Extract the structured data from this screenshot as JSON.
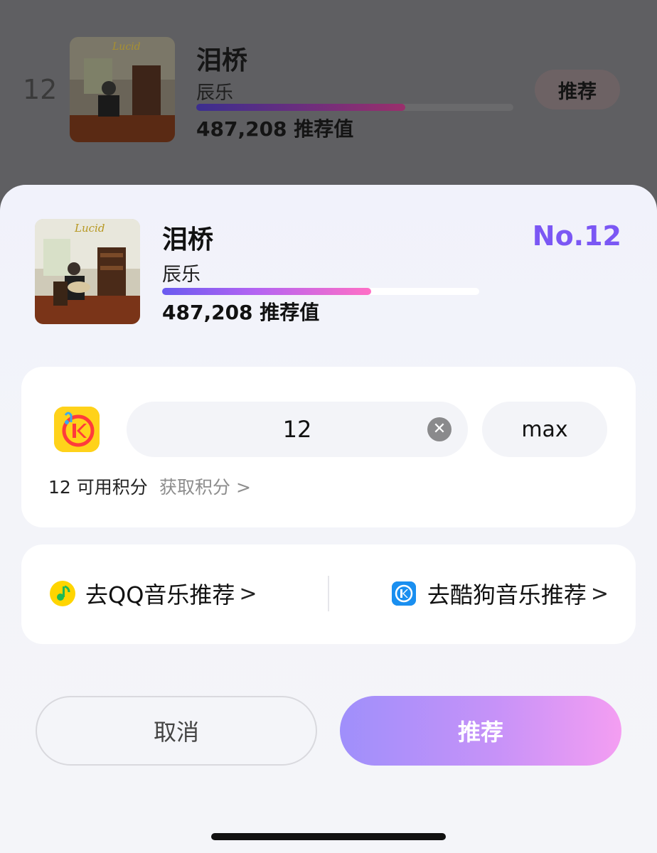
{
  "background_row": {
    "rank": "12",
    "song_title": "泪桥",
    "artist": "辰乐",
    "progress": 0.66,
    "score": "487,208 推荐值",
    "button_label": "推荐",
    "cover_text": "Lucid"
  },
  "sheet": {
    "song_title": "泪桥",
    "artist": "辰乐",
    "progress": 0.66,
    "score": "487,208 推荐值",
    "rank_label": "No.12",
    "cover_text": "Lucid"
  },
  "vote_card": {
    "app_icon": "kuwo-music-icon",
    "quantity_value": "12",
    "max_label": "max",
    "available_points": "12 可用积分",
    "get_points_link": "获取积分 >"
  },
  "links": {
    "qq_label": "去QQ音乐推荐",
    "kugou_label": "去酷狗音乐推荐",
    "chevron": ">"
  },
  "actions": {
    "cancel_label": "取消",
    "confirm_label": "推荐"
  },
  "colors": {
    "accent": "#7b57f4",
    "confirm_gradient_start": "#9f8ffb",
    "confirm_gradient_end": "#f49ef2"
  }
}
